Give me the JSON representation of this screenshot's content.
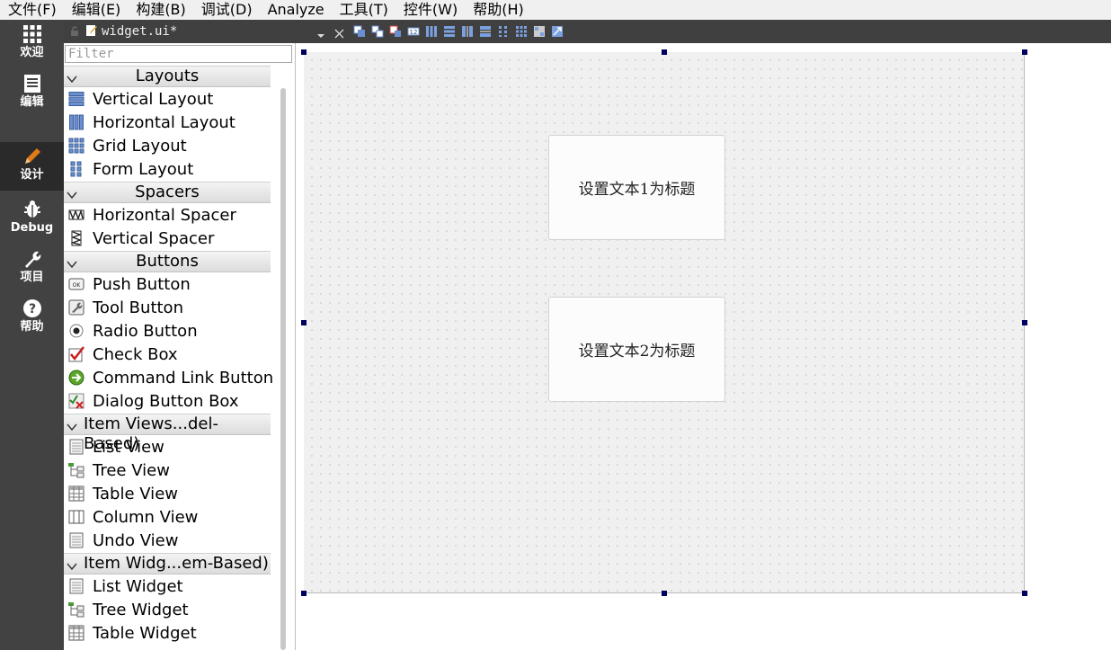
{
  "menubar": {
    "items": [
      "文件(F)",
      "编辑(E)",
      "构建(B)",
      "调试(D)",
      "Analyze",
      "工具(T)",
      "控件(W)",
      "帮助(H)"
    ]
  },
  "modebar": {
    "modes": [
      {
        "label": "欢迎",
        "icon": "grid-icon"
      },
      {
        "label": "编辑",
        "icon": "document-icon"
      },
      {
        "label": "设计",
        "icon": "pencil-icon",
        "active": true
      },
      {
        "label": "Debug",
        "icon": "bug-icon"
      },
      {
        "label": "项目",
        "icon": "wrench-icon"
      },
      {
        "label": "帮助",
        "icon": "help-icon"
      }
    ]
  },
  "editor": {
    "file_tab": "widget.ui*"
  },
  "widgetbox": {
    "filter_placeholder": "Filter",
    "categories": [
      {
        "name": "Layouts",
        "items": [
          "Vertical Layout",
          "Horizontal Layout",
          "Grid Layout",
          "Form Layout"
        ]
      },
      {
        "name": "Spacers",
        "items": [
          "Horizontal Spacer",
          "Vertical Spacer"
        ]
      },
      {
        "name": "Buttons",
        "items": [
          "Push Button",
          "Tool Button",
          "Radio Button",
          "Check Box",
          "Command Link Button",
          "Dialog Button Box"
        ]
      },
      {
        "name": "Item Views...del-Based)",
        "items": [
          "List View",
          "Tree View",
          "Table View",
          "Column View",
          "Undo View"
        ]
      },
      {
        "name": "Item Widg...em-Based)",
        "items": [
          "List Widget",
          "Tree Widget",
          "Table Widget"
        ]
      }
    ]
  },
  "form": {
    "button1": "设置文本1为标题",
    "button2": "设置文本2为标题"
  },
  "colors": {
    "modebar_bg": "#424242",
    "toolbar_bg": "#404040",
    "handle": "#000060"
  }
}
